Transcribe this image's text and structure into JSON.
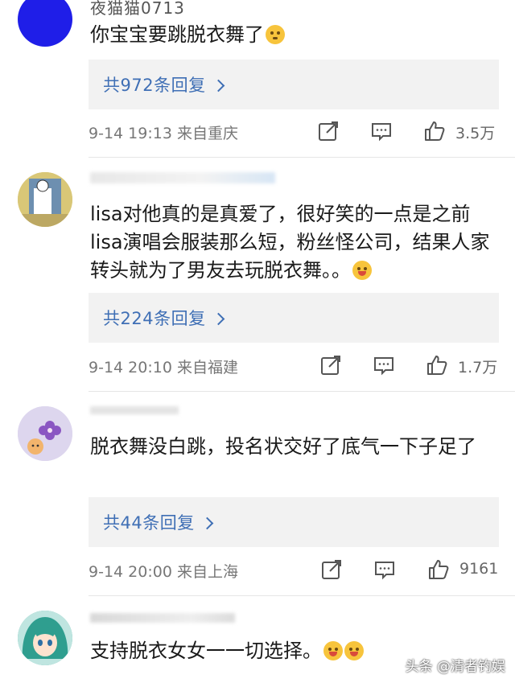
{
  "comments": [
    {
      "username": "夜猫猫0713",
      "text": "你宝宝要跳脱衣舞了",
      "emoji": "thinking-face",
      "replies": "共972条回复",
      "meta": "9-14 19:13 来自重庆",
      "likes": "3.5万"
    },
    {
      "username": "",
      "text": "lisa对他真的是真爱了，很好笑的一点是之前lisa演唱会服装那么短，粉丝怪公司，结果人家转头就为了男友去玩脱衣舞。。",
      "emoji": "grinning-sweat-face",
      "replies": "共224条回复",
      "meta": "9-14 20:10 来自福建",
      "likes": "1.7万"
    },
    {
      "username": "",
      "text": "脱衣舞没白跳，投名状交好了底气一下子足了",
      "emoji": "",
      "replies": "共44条回复",
      "meta": "9-14 20:00 来自上海",
      "likes": "9161"
    },
    {
      "username": "",
      "text": "支持脱衣女女一一切选择。",
      "emoji": "grinning-sweat-face x2",
      "replies": "",
      "meta": "",
      "likes": ""
    }
  ],
  "watermark": "头条 @清者钓娱",
  "colors": {
    "reply_link": "#3f6fb5",
    "reply_bg": "#f2f2f2",
    "avatar1": "#1f1ee8"
  }
}
